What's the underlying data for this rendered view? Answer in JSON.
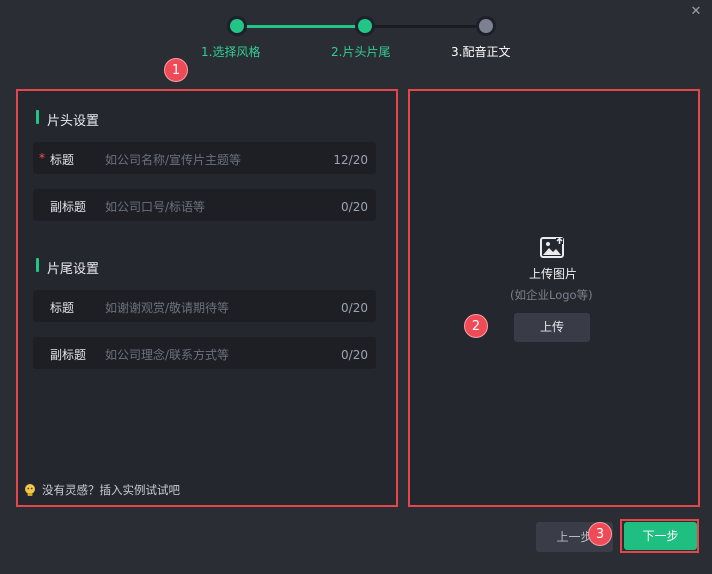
{
  "window": {
    "close_symbol": "✕"
  },
  "stepper": {
    "steps": [
      {
        "label": "1.选择风格",
        "state": "done"
      },
      {
        "label": "2.片头片尾",
        "state": "done"
      },
      {
        "label": "3.配音正文",
        "state": "current"
      }
    ]
  },
  "badges": [
    "1",
    "2",
    "3"
  ],
  "intro": {
    "title": "片头设置",
    "fields": [
      {
        "label": "标题",
        "required": "*",
        "placeholder": "如公司名称/宣传片主题等",
        "count": "12/20"
      },
      {
        "label": "副标题",
        "placeholder": "如公司口号/标语等",
        "count": "0/20"
      }
    ]
  },
  "outro": {
    "title": "片尾设置",
    "fields": [
      {
        "label": "标题",
        "placeholder": "如谢谢观赏/敬请期待等",
        "count": "0/20"
      },
      {
        "label": "副标题",
        "placeholder": "如公司理念/联系方式等",
        "count": "0/20"
      }
    ]
  },
  "tip": {
    "text": "没有灵感？插入实例试试吧",
    "icon": "lightbulb-icon"
  },
  "upload": {
    "icon": "image-upload-icon",
    "title": "上传图片",
    "subtitle": "(如企业Logo等)",
    "button_label": "上传"
  },
  "footer": {
    "prev_label": "上一步",
    "next_label": "下一步"
  },
  "colors": {
    "accent": "#23c587",
    "annotation": "#e5464c",
    "background": "#2b2d35"
  }
}
